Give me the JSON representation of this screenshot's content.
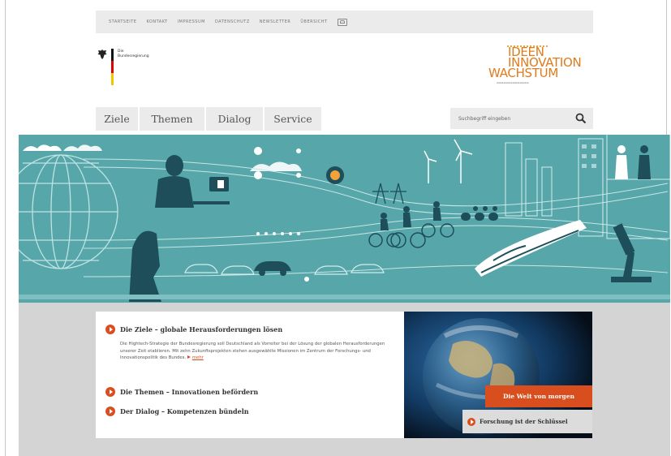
{
  "topnav": {
    "items": [
      "STARTSEITE",
      "KONTAKT",
      "IMPRESSUM",
      "DATENSCHUTZ",
      "NEWSLETTER",
      "ÜBERSICHT"
    ],
    "sign_language_icon": "sign-language-icon"
  },
  "header": {
    "gov_logo_text_line1": "Die",
    "gov_logo_text_line2": "Bundesregierung",
    "idw_logo": {
      "line1": "IDEEN",
      "line2": "INNOVATION",
      "line3": "WACHSTUM"
    }
  },
  "mainnav": {
    "tabs": [
      "Ziele",
      "Themen",
      "Dialog",
      "Service"
    ]
  },
  "search": {
    "placeholder": "Suchbegriff eingeben",
    "icon": "magnifier-icon"
  },
  "colors": {
    "accent": "#d94e1f",
    "hero": "#57a6aa",
    "idw_orange": "#e07b1c",
    "nav_bg": "#ebebeb"
  },
  "teaser": {
    "items": [
      {
        "title": "Die Ziele – globale Herausforderungen lösen",
        "text": "Die Hightech-Strategie der Bundesregierung soll Deutschland als Vorreiter bei der Lösung der globalen Herausforderungen unserer Zeit etablieren. Mit zehn Zukunftsprojekten stehen ausgewählte Missionen im Zentrum der Forschungs- und Innovationspolitik des Bundes.",
        "more": "mehr"
      },
      {
        "title": "Die Themen – Innovationen befördern"
      },
      {
        "title": "Der Dialog – Kompetenzen bündeln"
      }
    ]
  },
  "photo": {
    "banner": "Die Welt von morgen",
    "caption": "Forschung ist der Schlüssel"
  }
}
